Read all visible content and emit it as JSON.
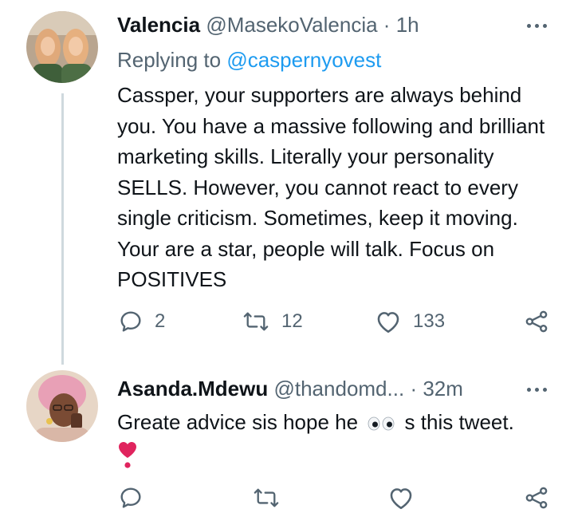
{
  "tweets": [
    {
      "name": "Valencia",
      "handle": "@MasekoValencia",
      "separator": "·",
      "time": "1h",
      "replying_label": "Replying to ",
      "replying_mention": "@caspernyovest",
      "body": "Cassper, your supporters are always behind you. You have a massive following and brilliant marketing skills. Literally your personality SELLS. However, you cannot react to every single criticism. Sometimes, keep it moving. Your are a star, people will talk. Focus on POSITIVES",
      "reply_count": "2",
      "retweet_count": "12",
      "like_count": "133"
    },
    {
      "name": "Asanda.Mdewu",
      "handle": "@thandomd...",
      "separator": "·",
      "time": "32m",
      "body_before": "Greate advice sis hope he",
      "body_after": "s this tweet.",
      "emoji_eyes": "👀",
      "emoji_heart": "❣"
    }
  ],
  "icons": {
    "reply": "reply-icon",
    "retweet": "retweet-icon",
    "like": "heart-icon",
    "share": "share-icon",
    "more": "more-icon"
  },
  "colors": {
    "text": "#0f1419",
    "secondary": "#536471",
    "link": "#1d9bf0",
    "thread_line": "#cfd9de",
    "heart_emoji": "#e0245e"
  }
}
